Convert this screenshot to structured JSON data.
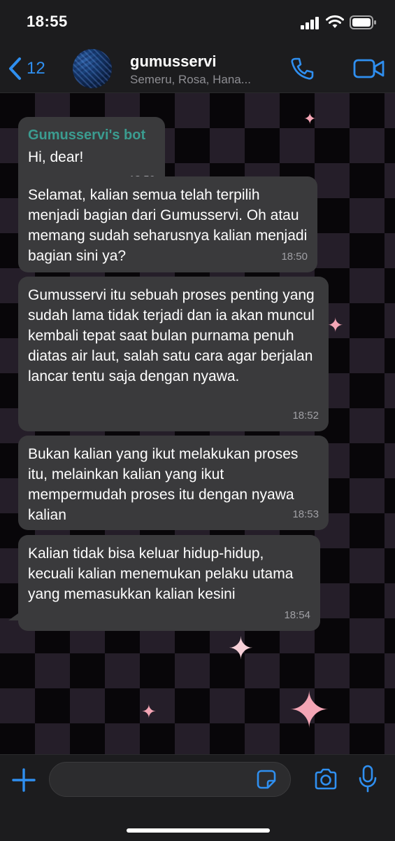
{
  "status_bar": {
    "time": "18:55"
  },
  "header": {
    "back_count": "12",
    "title": "gumusservi",
    "subtitle": "Semeru, Rosa, Hana..."
  },
  "messages": [
    {
      "sender": "Gumusservi's bot",
      "text": "Hi, dear!",
      "time": "18:50"
    },
    {
      "text": "Selamat, kalian semua telah terpilih menjadi bagian dari Gumusservi. Oh atau memang sudah seharusnya kalian menjadi bagian sini ya?",
      "time": "18:50"
    },
    {
      "text": "Gumusservi itu sebuah proses penting yang sudah lama tidak terjadi dan ia akan muncul kembali tepat saat bulan purnama penuh diatas air laut, salah satu cara agar berjalan lancar tentu saja dengan nyawa.",
      "time": "18:52"
    },
    {
      "text": "Bukan kalian yang ikut melakukan proses itu, melainkan kalian yang ikut mempermudah proses itu dengan nyawa kalian",
      "time": "18:53"
    },
    {
      "text": "Kalian tidak bisa keluar hidup-hidup, kecuali kalian menemukan pelaku utama yang memasukkan kalian kesini",
      "time": "18:54"
    }
  ],
  "composer": {
    "value": ""
  },
  "colors": {
    "accent": "#2f8ff0",
    "bubble": "#3a3a3c",
    "sender": "#3b9c90"
  },
  "icons": [
    "back-chevron-icon",
    "phone-icon",
    "video-icon",
    "plus-icon",
    "sticker-icon",
    "camera-icon",
    "mic-icon",
    "signal-icon",
    "wifi-icon",
    "battery-icon"
  ]
}
